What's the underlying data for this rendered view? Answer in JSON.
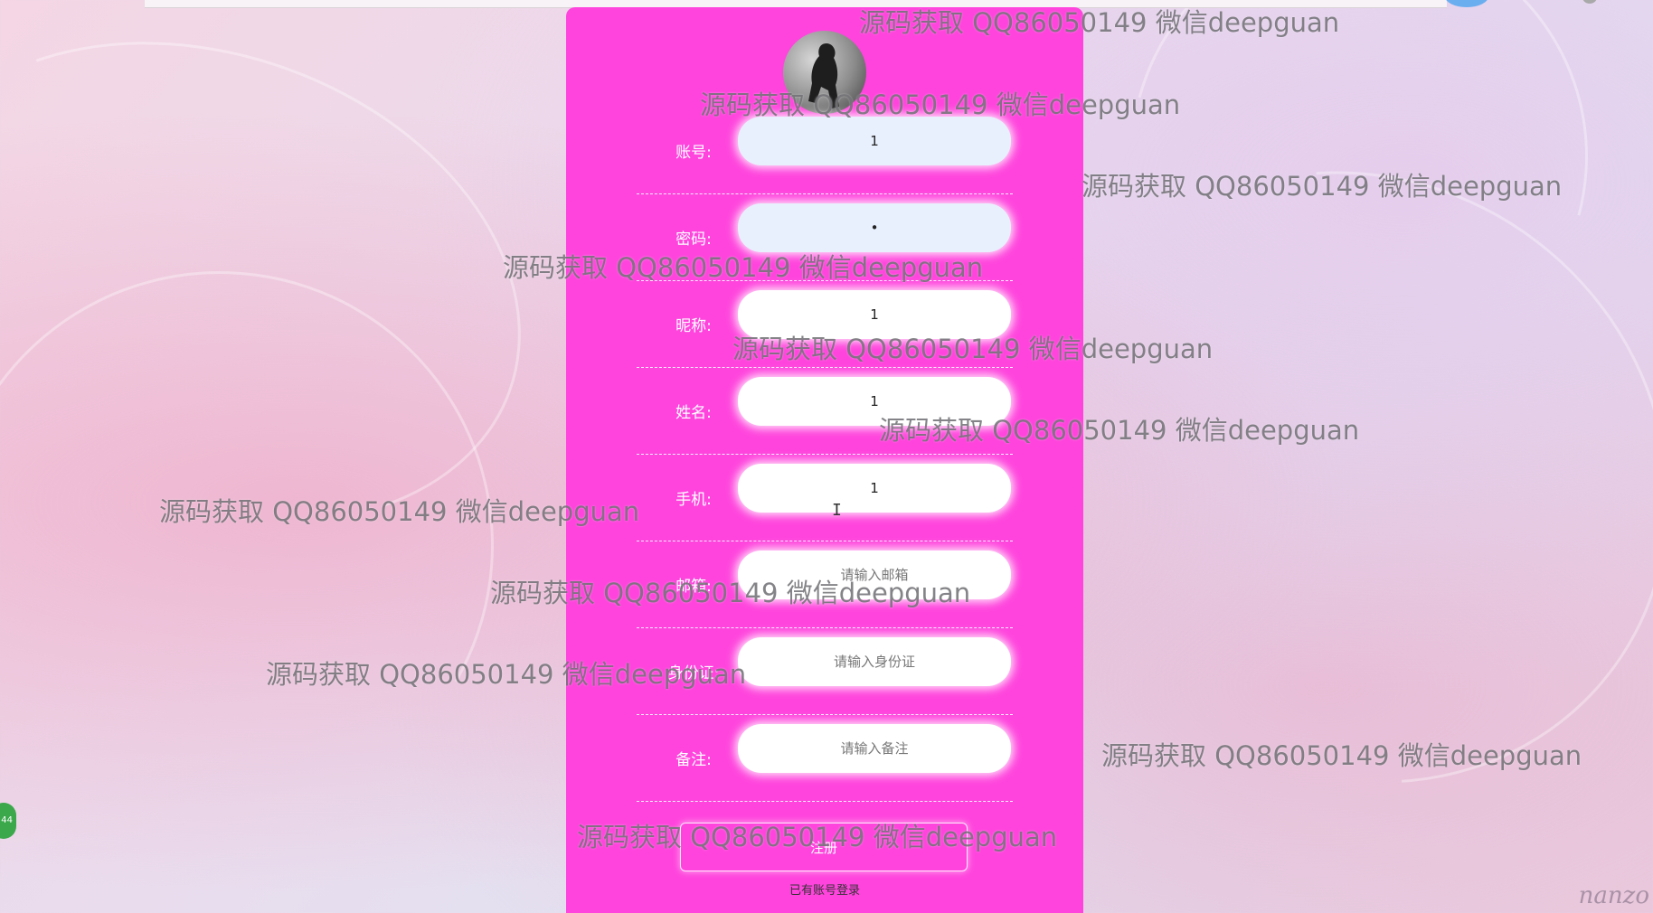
{
  "form": {
    "fields": [
      {
        "label": "账号:",
        "value": "1",
        "placeholder": ""
      },
      {
        "label": "密码:",
        "value": "•",
        "placeholder": ""
      },
      {
        "label": "昵称:",
        "value": "1",
        "placeholder": ""
      },
      {
        "label": "姓名:",
        "value": "1",
        "placeholder": ""
      },
      {
        "label": "手机:",
        "value": "1",
        "placeholder": ""
      },
      {
        "label": "邮箱:",
        "value": "",
        "placeholder": "请输入邮箱"
      },
      {
        "label": "身份证:",
        "value": "",
        "placeholder": "请输入身份证"
      },
      {
        "label": "备注:",
        "value": "",
        "placeholder": "请输入备注"
      }
    ],
    "submit_label": "注册",
    "login_link": "已有账号登录"
  },
  "watermark_text": "源码获取 QQ86050149 微信deepguan",
  "side_badge": "44",
  "corner_mark": "nanzo",
  "colors": {
    "panel": "#ff44dd",
    "filled_input": "#e8f0fe",
    "empty_input": "#ffffff",
    "watermark": "#6e6e73"
  },
  "icons": [
    "avatar-image",
    "text-cursor-icon"
  ]
}
